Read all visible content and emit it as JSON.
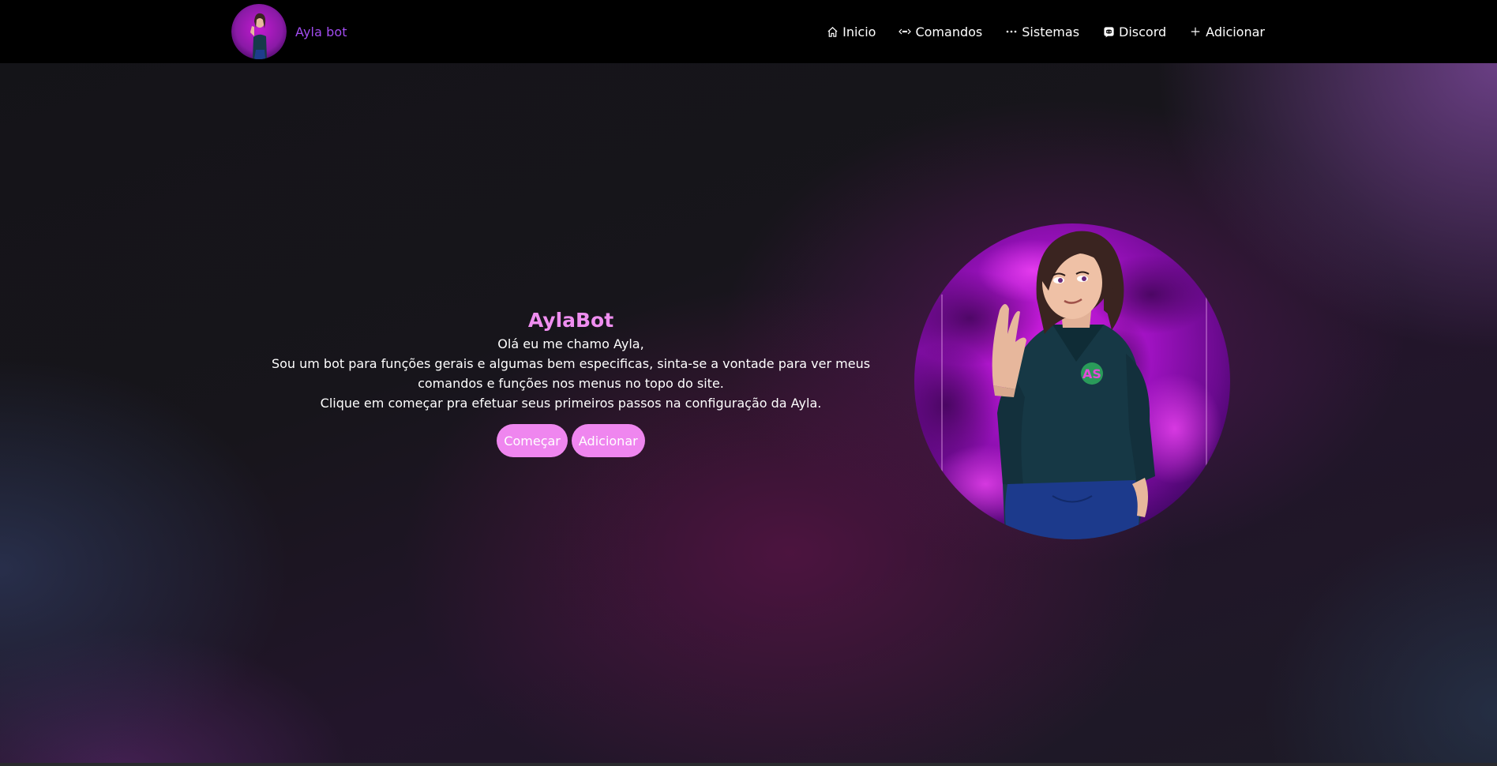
{
  "navbar": {
    "brand": {
      "name": "Ayla bot",
      "avatar_icon": "ayla-avatar-icon"
    },
    "links": [
      {
        "label": "Inicio",
        "icon": "home-icon"
      },
      {
        "label": "Comandos",
        "icon": "code-arrows-icon"
      },
      {
        "label": "Sistemas",
        "icon": "ellipsis-icon"
      },
      {
        "label": "Discord",
        "icon": "discord-icon"
      },
      {
        "label": "Adicionar",
        "icon": "plus-icon"
      }
    ]
  },
  "hero": {
    "title": "AylaBot",
    "greeting": "Olá eu me chamo Ayla,",
    "description_line1": "Sou um bot para funções gerais e algumas bem especificas, sinta-se a vontade para ver meus",
    "description_line2": "comandos e funções nos menus no topo do site.",
    "cta_text": "Clique em começar pra efetuar seus primeiros passos na configuração da Ayla.",
    "buttons": {
      "start": "Começar",
      "add": "Adicionar"
    }
  },
  "colors": {
    "brand_text": "#a24cf0",
    "title": "#ef8ef0",
    "button_bg": "#ef86ef",
    "navbar_bg": "#000000"
  }
}
